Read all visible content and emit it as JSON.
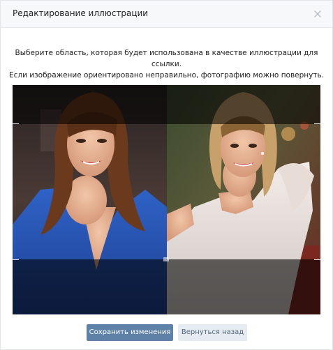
{
  "modal": {
    "title": "Редактирование иллюстрации",
    "close_icon": "close-icon"
  },
  "instructions": {
    "line1": "Выберите область, которая будет использована в качестве иллюстрации для ссылки.",
    "line2": "Если изображение ориентировано неправильно, фотографию можно повернуть."
  },
  "cropper": {
    "image_description": "photo-two-women",
    "overlay_color": "#000000"
  },
  "footer": {
    "save_label": "Сохранить изменения",
    "back_label": "Вернуться назад"
  },
  "colors": {
    "primary_button": "#5e81a8",
    "secondary_button": "#e5ebf1",
    "secondary_text": "#55677d",
    "header_bg": "#f7f8fa"
  }
}
